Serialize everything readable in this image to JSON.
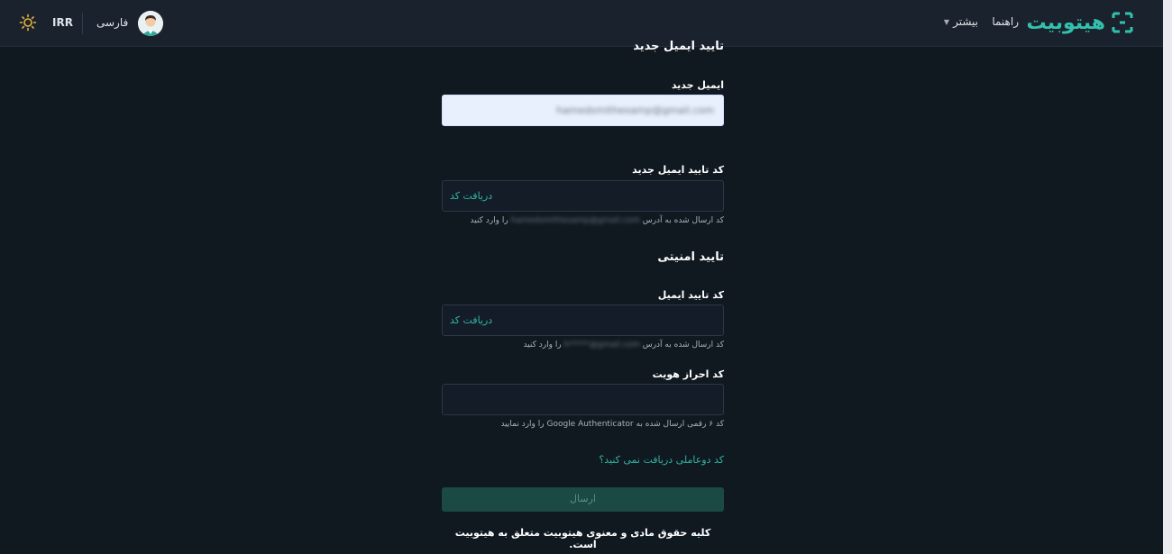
{
  "header": {
    "logo_text": "هیتوبیت",
    "nav_more": "بیشتر",
    "nav_help": "راهنما",
    "language": "فارسی",
    "currency": "IRR",
    "brand_color": "#33c1ae"
  },
  "form": {
    "new_email_title": "تایید ایمیل جدید",
    "new_email_label": "ایمیل جدید",
    "new_email_value": "hamedsmithexamp@gmail.com",
    "new_email_code_label": "کد تایید ایمیل جدید",
    "get_code_1": "دریافت کد",
    "hint_1_prefix": "کد ارسال شده به آدرس",
    "hint_1_blur": "hamedsmithexamp@gmail.com",
    "hint_1_suffix": "را وارد کنید",
    "security_title": "تایید امنیتی",
    "email_code_label": "کد تایید ایمیل",
    "get_code_2": "دریافت کد",
    "hint_2_prefix": "کد ارسال شده به آدرس",
    "hint_2_blur": "h*****@gmail.com",
    "hint_2_suffix": "را وارد کنید",
    "auth_code_label": "کد احراز هویت",
    "hint_3": "کد ۶ رقمی ارسال شده به Google Authenticator را وارد نمایید",
    "no_2fa_link": "کد دوعاملی دریافت نمی کنید؟",
    "submit_label": "ارسال"
  },
  "footer": {
    "copyright": "کلیه حقوق مادی و معنوی هیتوبیت متعلق به هیتوبیت است."
  },
  "icons": {
    "theme": "sun-icon",
    "logo_mark": "bracket-logo-icon",
    "more_caret": "caret-down-icon"
  }
}
